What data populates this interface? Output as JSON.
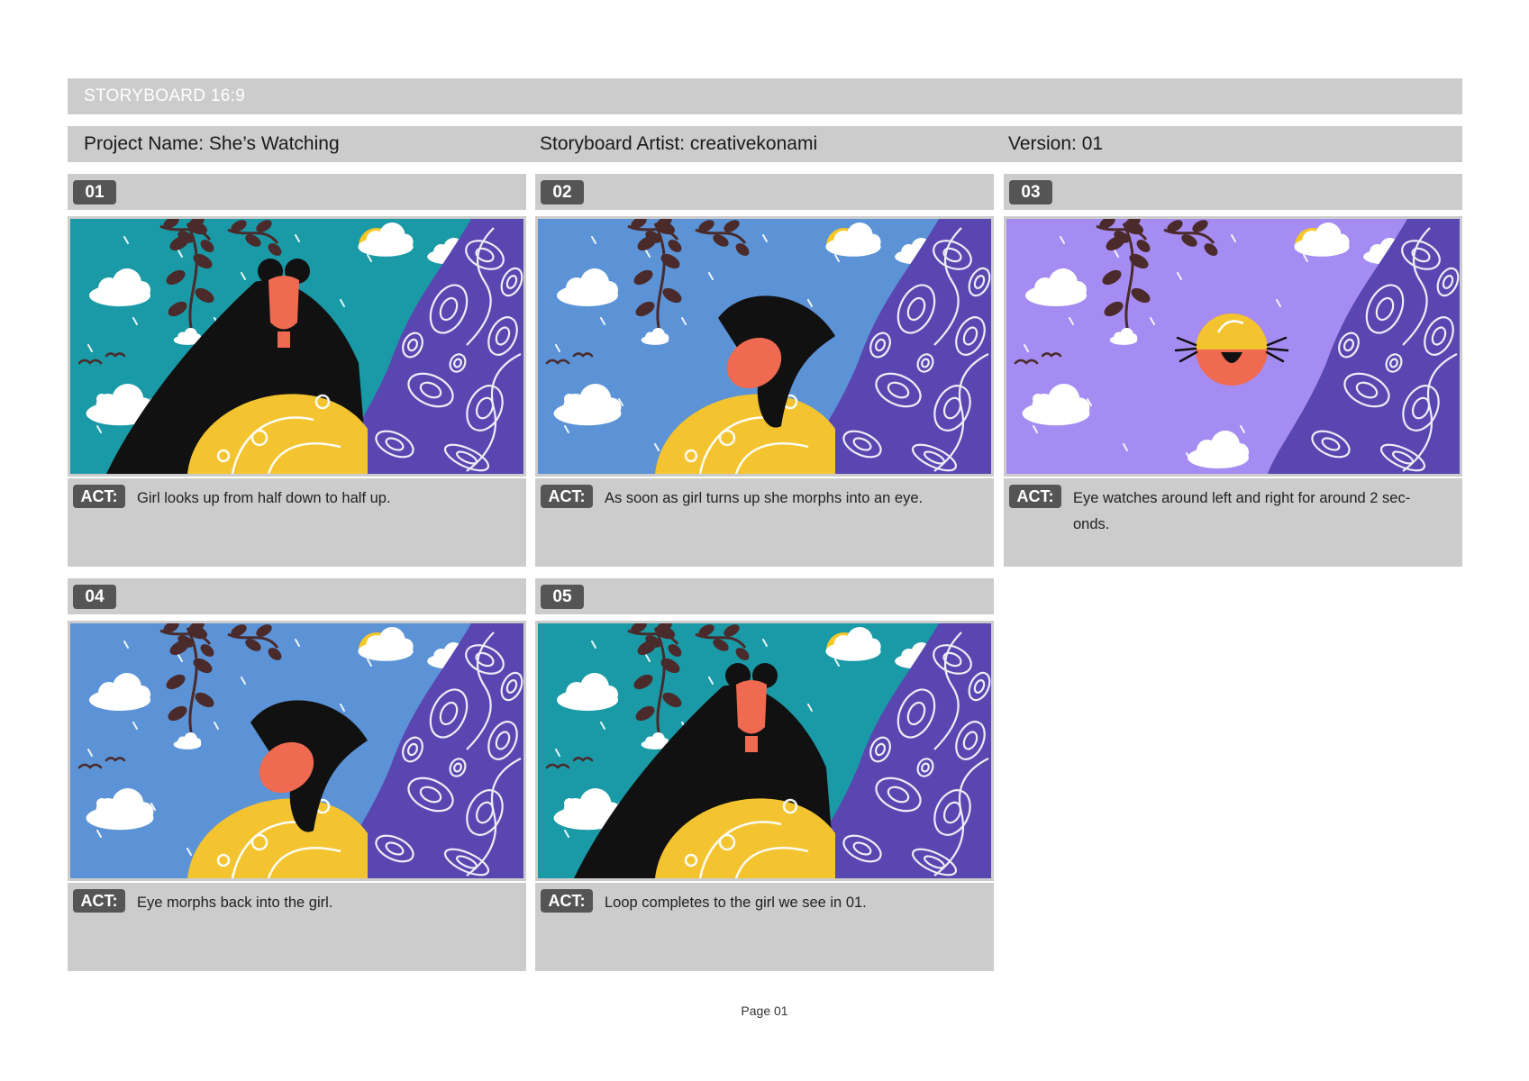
{
  "header": {
    "title": "STORYBOARD 16:9",
    "project": "Project Name: She’s Watching",
    "artist": "Storyboard Artist: creativekonami",
    "version": "Version: 01"
  },
  "act_label": "ACT:",
  "colors": {
    "bar_gray": "#cccccc",
    "badge_gray": "#555555",
    "sky_teal": "#1a9aa6",
    "sky_blue": "#5b93d6",
    "sky_lilac": "#a58cf2",
    "pattern_purple": "#5a46b0",
    "dress_yellow": "#f4c430",
    "face_coral": "#ef6a50",
    "hair_black": "#111111",
    "plant_brown": "#4a2a2a",
    "sun_yellow": "#f6c828"
  },
  "panels": [
    {
      "number": "01",
      "scene": "girl-front",
      "sky": "teal",
      "action": "Girl looks up from half down to half up."
    },
    {
      "number": "02",
      "scene": "girl-tilt",
      "sky": "blue",
      "action": "As soon as girl turns up she morphs into an eye."
    },
    {
      "number": "03",
      "scene": "eye",
      "sky": "lilac",
      "action": "Eye watches around left and right for around 2 sec-onds."
    },
    {
      "number": "04",
      "scene": "girl-tilt",
      "sky": "blue",
      "action": "Eye morphs back into the girl."
    },
    {
      "number": "05",
      "scene": "girl-front",
      "sky": "teal",
      "action": "Loop completes to the girl we see in 01."
    }
  ],
  "footer": {
    "page": "Page 01"
  }
}
